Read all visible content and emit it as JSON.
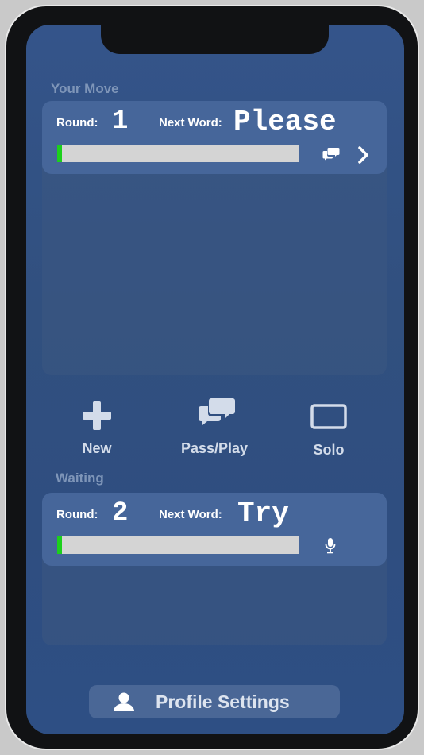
{
  "sections": {
    "your_move_label": "Your Move",
    "waiting_label": "Waiting"
  },
  "games": [
    {
      "round_label": "Round:",
      "round": "1",
      "next_word_label": "Next Word:",
      "next_word": "Please",
      "progress": 0.02,
      "icons": [
        "chat-bubbles-icon",
        "chevron-right-icon"
      ]
    },
    {
      "round_label": "Round:",
      "round": "2",
      "next_word_label": "Next Word:",
      "next_word": "Try",
      "progress": 0.02,
      "icons": [
        "microphone-icon"
      ]
    }
  ],
  "actions": [
    {
      "label": "New",
      "icon": "plus-icon"
    },
    {
      "label": "Pass/Play",
      "icon": "chat-bubbles-icon"
    },
    {
      "label": "Solo",
      "icon": "rectangle-icon"
    }
  ],
  "profile_button": {
    "label": "Profile Settings",
    "icon": "user-icon"
  },
  "colors": {
    "background": "#31507f",
    "card": "#46669a",
    "progress_fill": "#1cd01c",
    "progress_track": "#d4d4d4",
    "section_label": "#7e95b8"
  }
}
